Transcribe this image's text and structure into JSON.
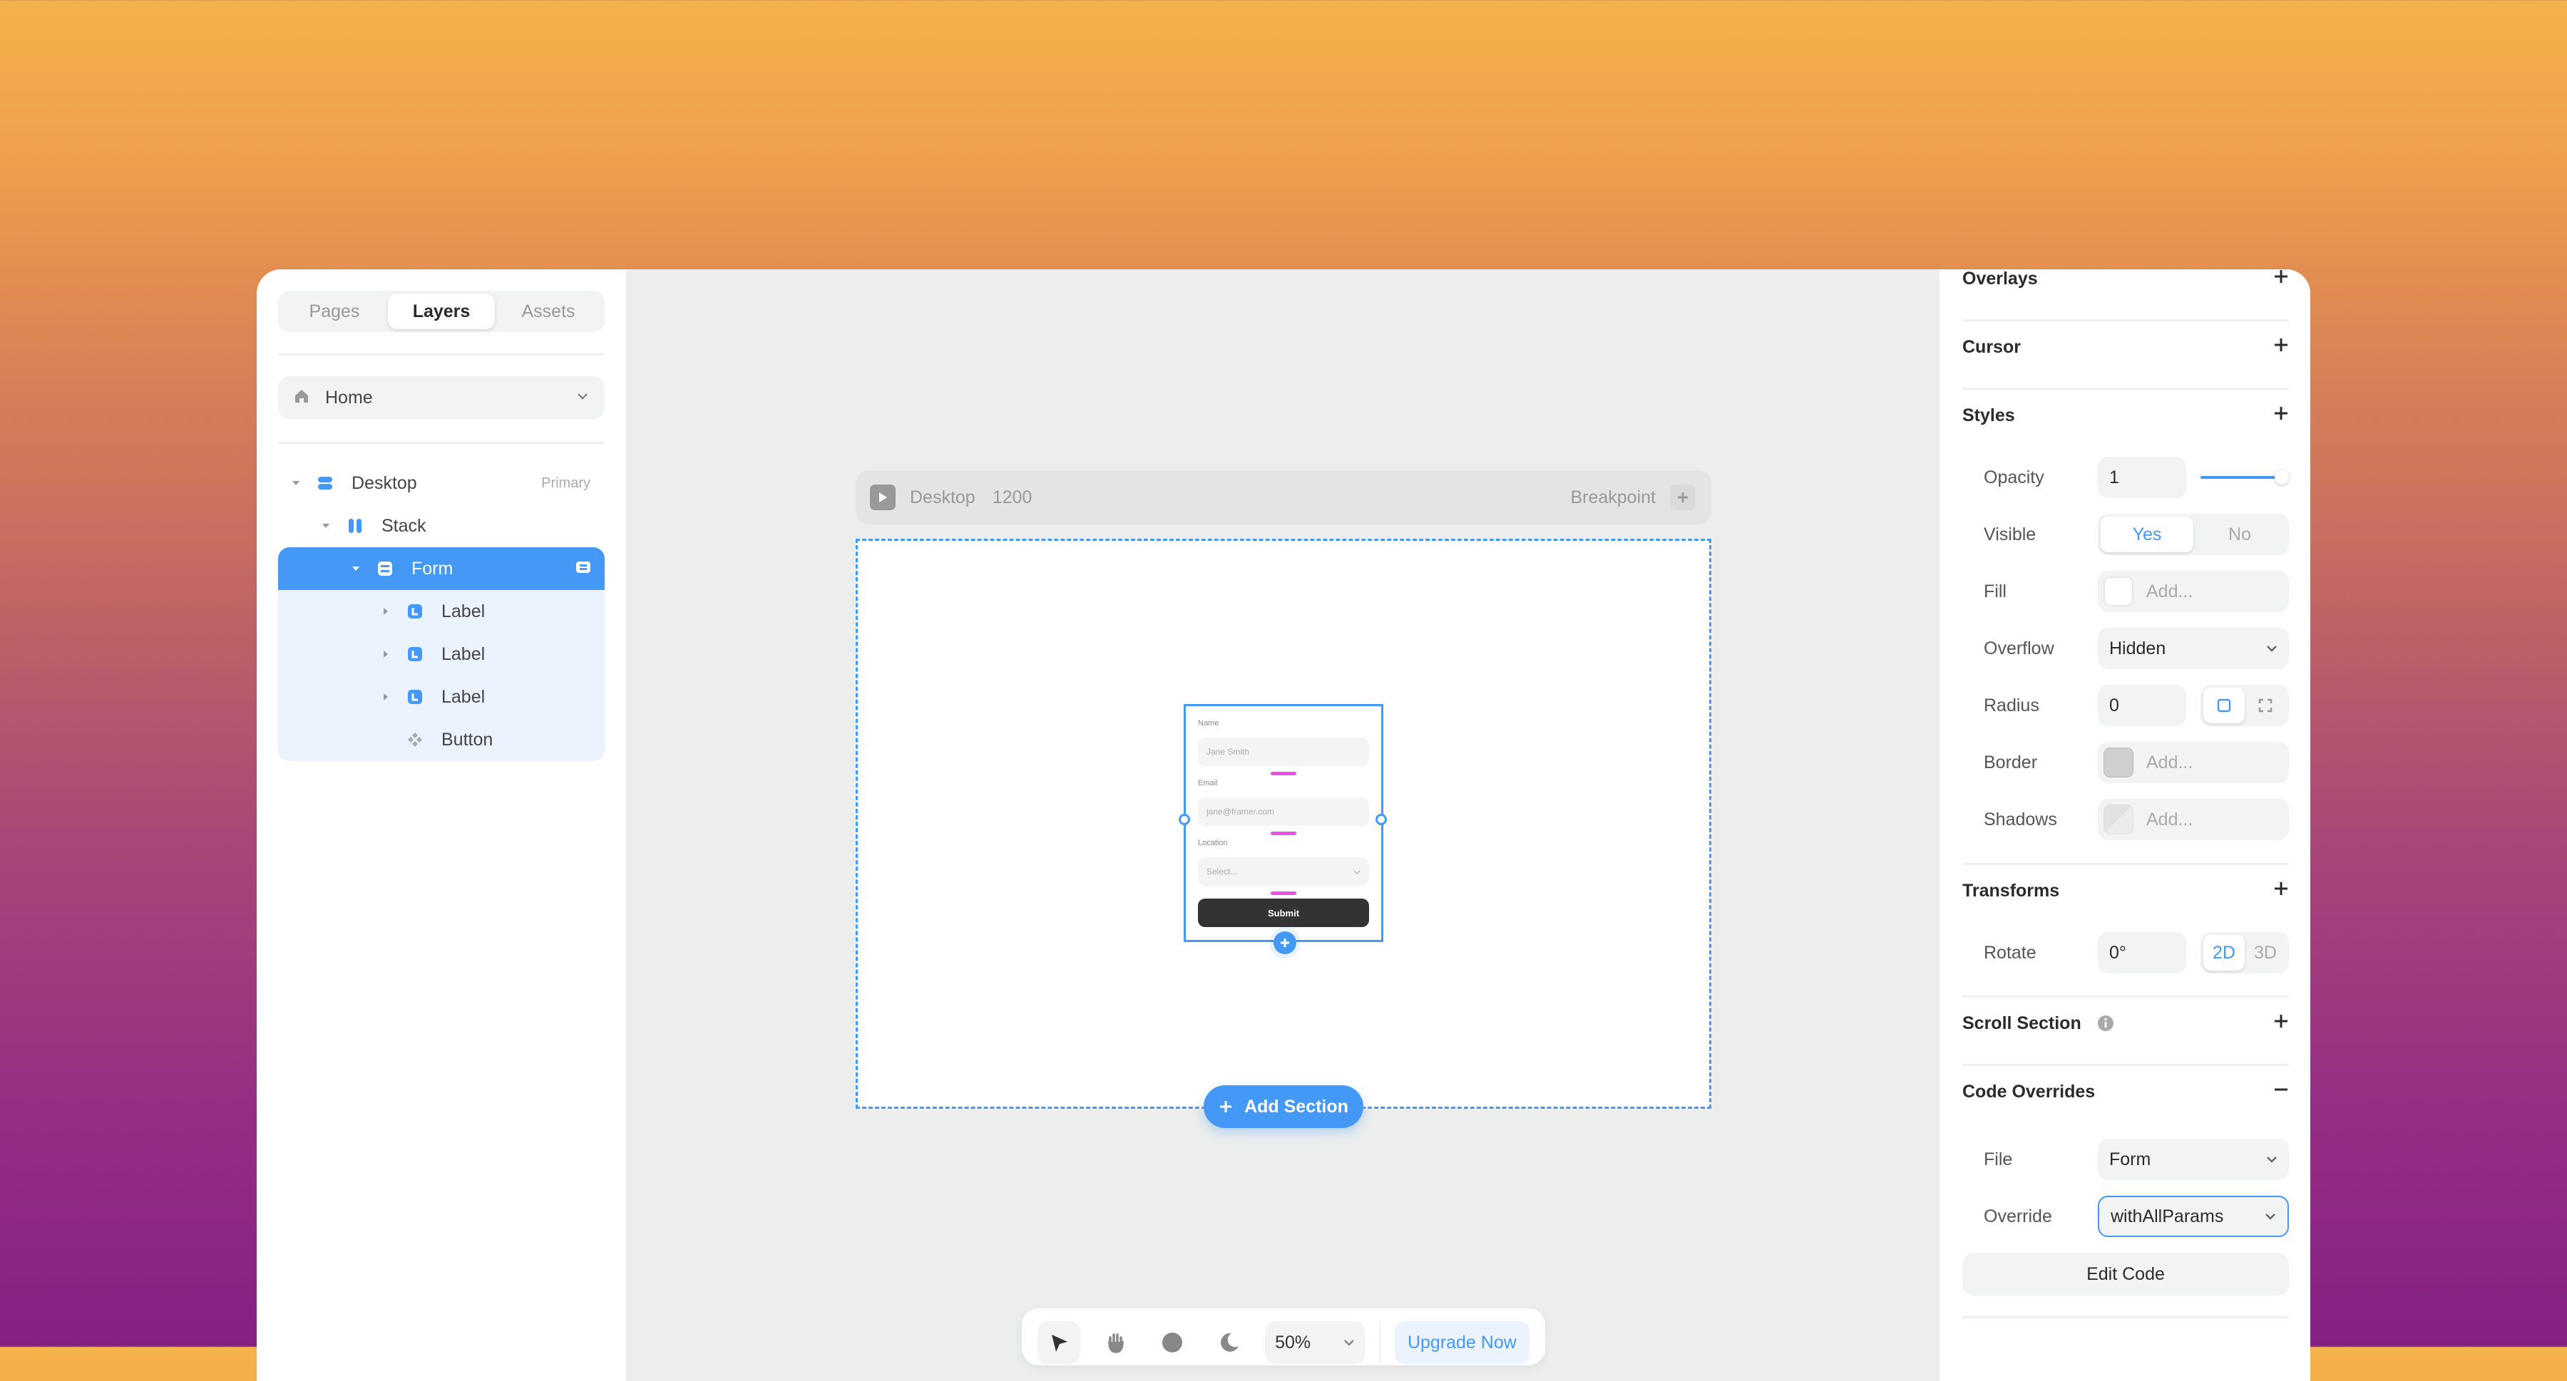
{
  "left_sidebar": {
    "tabs": [
      {
        "label": "Pages",
        "active": false
      },
      {
        "label": "Layers",
        "active": true
      },
      {
        "label": "Assets",
        "active": false
      }
    ],
    "page_selector": {
      "icon": "home-icon",
      "value": "Home"
    },
    "layers": [
      {
        "name": "Desktop",
        "icon": "desktop-frame-icon",
        "tag": "Primary",
        "expanded": true
      },
      {
        "name": "Stack",
        "icon": "stack-icon",
        "expanded": true
      },
      {
        "name": "Form",
        "icon": "form-icon",
        "selected": true,
        "expanded": true
      },
      {
        "name": "Label",
        "icon": "label-icon",
        "expanded": false
      },
      {
        "name": "Label",
        "icon": "label-icon",
        "expanded": false
      },
      {
        "name": "Label",
        "icon": "label-icon",
        "expanded": false
      },
      {
        "name": "Button",
        "icon": "component-icon"
      }
    ]
  },
  "canvas": {
    "breakpoint_bar": {
      "title": "Desktop",
      "width": "1200",
      "breakpoint_label": "Breakpoint"
    },
    "form_preview": {
      "fields": [
        {
          "label": "Name",
          "placeholder": "Jane Smith"
        },
        {
          "label": "Email",
          "placeholder": "jane@framer.com"
        },
        {
          "label": "Location",
          "placeholder": "Select..."
        }
      ],
      "submit_label": "Submit"
    },
    "add_section_label": "Add Section",
    "toolbar": {
      "zoom": "50%",
      "upgrade_label": "Upgrade Now"
    }
  },
  "right_panel": {
    "sections": {
      "overlays": "Overlays",
      "cursor": "Cursor",
      "styles": "Styles",
      "transforms": "Transforms",
      "scroll_section": "Scroll Section",
      "code_overrides": "Code Overrides"
    },
    "styles": {
      "opacity": {
        "label": "Opacity",
        "value": "1",
        "slider_fraction": 1.0
      },
      "visible": {
        "label": "Visible",
        "options": [
          "Yes",
          "No"
        ],
        "selected": "Yes"
      },
      "fill": {
        "label": "Fill",
        "placeholder": "Add..."
      },
      "overflow": {
        "label": "Overflow",
        "value": "Hidden"
      },
      "radius": {
        "label": "Radius",
        "value": "0"
      },
      "border": {
        "label": "Border",
        "placeholder": "Add..."
      },
      "shadows": {
        "label": "Shadows",
        "placeholder": "Add..."
      }
    },
    "transforms": {
      "rotate": {
        "label": "Rotate",
        "value": "0°",
        "modes": [
          "2D",
          "3D"
        ],
        "selected": "2D"
      }
    },
    "code_overrides": {
      "file": {
        "label": "File",
        "value": "Form"
      },
      "override": {
        "label": "Override",
        "value": "withAllParams"
      },
      "edit_code_label": "Edit Code"
    }
  },
  "colors": {
    "accent": "#4499f7",
    "spacing_guide": "#ea50e6",
    "canvas_bg": "#eceeed"
  }
}
